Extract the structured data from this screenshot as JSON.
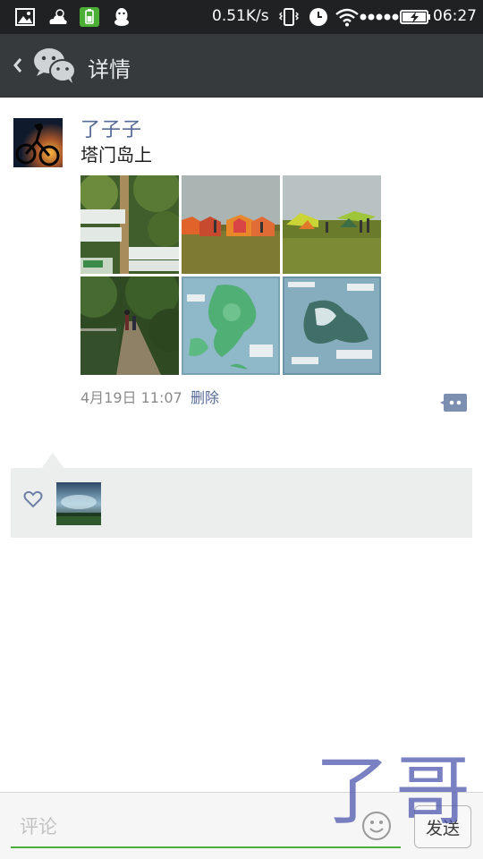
{
  "status_bar": {
    "icons": [
      "image-icon",
      "weather-icon",
      "battery-saver-icon",
      "qq-icon"
    ],
    "net_speed": "0.51K/s",
    "right_icons": [
      "vibrate-icon",
      "alarm-icon",
      "wifi-icon",
      "signal-icon",
      "battery-icon"
    ],
    "time": "06:27"
  },
  "header": {
    "back_icon": "chevron-left-icon",
    "app_icon": "wechat-icon",
    "title": "详情"
  },
  "post": {
    "author": "了子子",
    "content": "塔门岛上",
    "photos": [
      {
        "name": "photo-signpost"
      },
      {
        "name": "photo-tents"
      },
      {
        "name": "photo-campsite"
      },
      {
        "name": "photo-forest-path"
      },
      {
        "name": "photo-map-board"
      },
      {
        "name": "photo-map-board-2"
      }
    ],
    "time": "4月19日 11:07",
    "delete_label": "删除",
    "comment_icon": "comment-icon"
  },
  "likes": {
    "icon": "heart-icon",
    "users": [
      {
        "name": "liker-avatar"
      }
    ]
  },
  "comment_bar": {
    "placeholder": "评论",
    "emoji_icon": "emoji-icon",
    "send_label": "发送"
  },
  "watermark": "了哥"
}
